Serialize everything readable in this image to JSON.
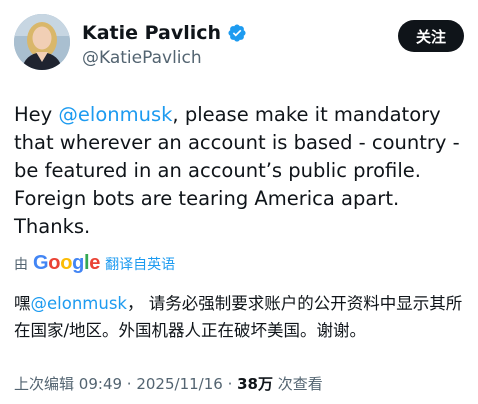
{
  "profile": {
    "display_name": "Katie Pavlich",
    "handle": "@KatiePavlich",
    "follow_label": "关注"
  },
  "tweet": {
    "text_before": "Hey ",
    "mention": "@elonmusk",
    "text_after": ", please make it mandatory that wherever an account is based - country - be featured in an account’s public profile. Foreign bots are tearing America apart. Thanks."
  },
  "translation": {
    "by_label": "由",
    "google": [
      "G",
      "o",
      "o",
      "g",
      "l",
      "e"
    ],
    "google_colors": [
      "#4285F4",
      "#EA4335",
      "#FBBC05",
      "#4285F4",
      "#34A853",
      "#EA4335"
    ],
    "link_label": "翻译自英语",
    "text_before": "嘿",
    "mention": "@elonmusk",
    "text_after": "， 请务必强制要求账户的公开资料中显示其所在国家/地区。外国机器人正在破坏美国。谢谢。"
  },
  "meta": {
    "edited_label": "上次编辑",
    "time": "09:49",
    "sep1": " · ",
    "date": "2025/11/16",
    "sep2": " · ",
    "views_count": "38万",
    "views_label": "次查看"
  },
  "colors": {
    "accent": "#1d9bf0",
    "verified": "#1d9bf0",
    "text": "#0f1419",
    "secondary": "#536471"
  }
}
